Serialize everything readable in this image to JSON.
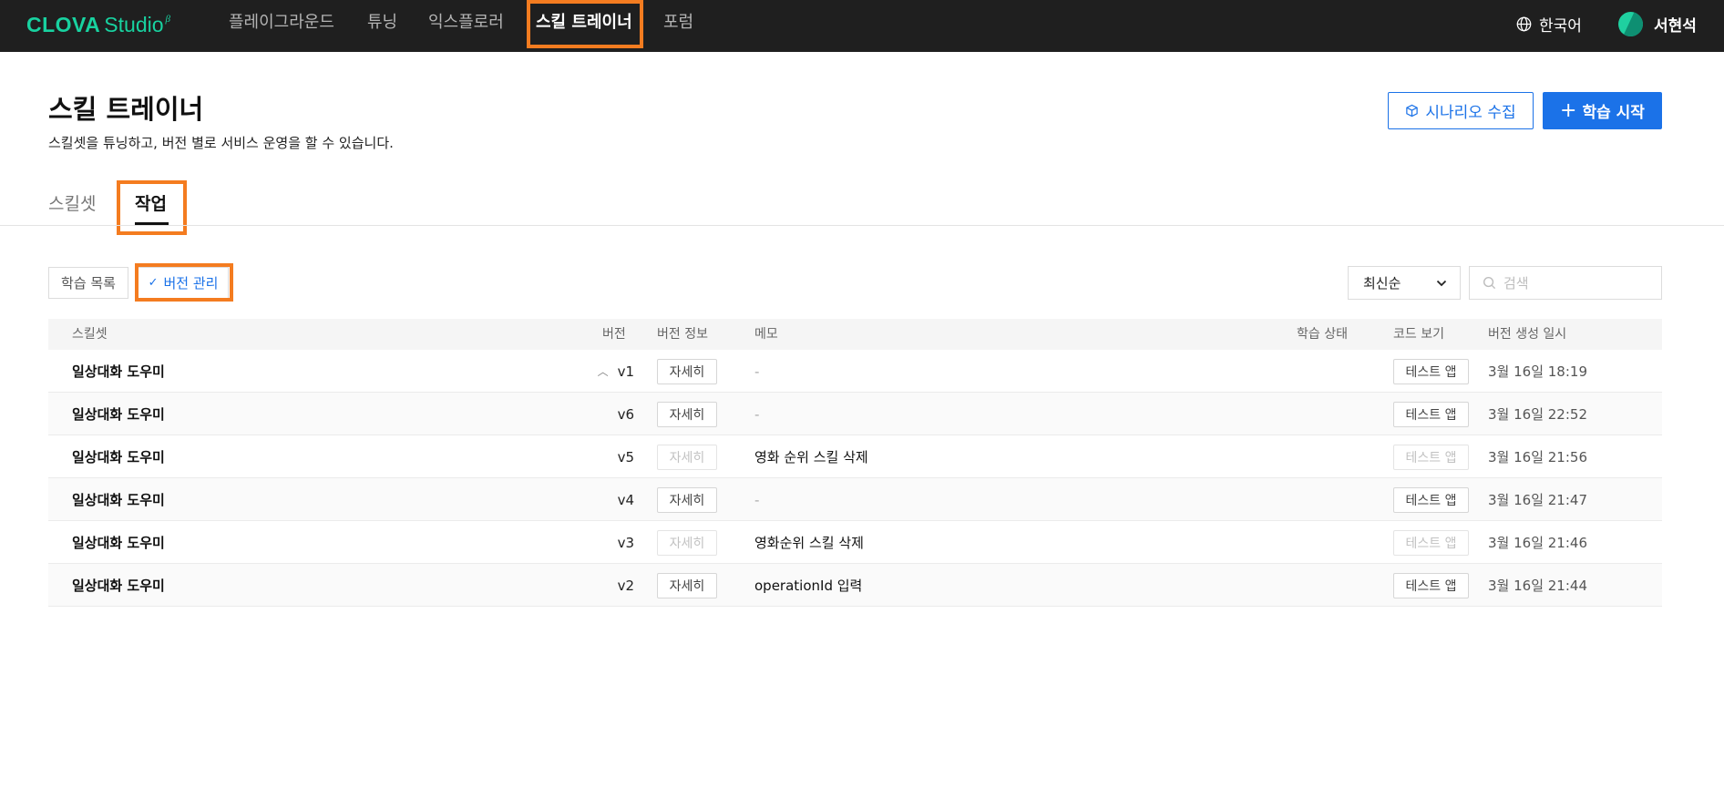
{
  "nav": {
    "logo_main": "CLOVA",
    "logo_sub": "Studio",
    "logo_beta": "β",
    "items": [
      "플레이그라운드",
      "튜닝",
      "익스플로러",
      "스킬 트레이너",
      "포럼"
    ],
    "language": "한국어",
    "user_name": "서현석"
  },
  "header": {
    "title": "스킬 트레이너",
    "description": "스킬셋을 튜닝하고, 버전 별로 서비스 운영을 할 수 있습니다.",
    "collect_button": "시나리오 수집",
    "start_button": "학습 시작"
  },
  "tabs": [
    "스킬셋",
    "작업"
  ],
  "toolbar": {
    "learn_list": "학습 목록",
    "version_manage": "버전 관리",
    "sort_value": "최신순",
    "search_placeholder": "검색"
  },
  "table": {
    "columns": [
      "스킬셋",
      "버전",
      "버전 정보",
      "메모",
      "학습 상태",
      "코드 보기",
      "버전 생성 일시"
    ],
    "detail_label": "자세히",
    "test_app_label": "테스트 앱",
    "rows": [
      {
        "skill": "일상대화 도우미",
        "version": "v1",
        "expanded": true,
        "detail_enabled": true,
        "memo": "-",
        "test_enabled": true,
        "date": "3월 16일 18:19"
      },
      {
        "skill": "일상대화 도우미",
        "version": "v6",
        "expanded": false,
        "detail_enabled": true,
        "memo": "-",
        "test_enabled": true,
        "date": "3월 16일 22:52"
      },
      {
        "skill": "일상대화 도우미",
        "version": "v5",
        "expanded": false,
        "detail_enabled": false,
        "memo": "영화 순위 스킬 삭제",
        "test_enabled": false,
        "date": "3월 16일 21:56"
      },
      {
        "skill": "일상대화 도우미",
        "version": "v4",
        "expanded": false,
        "detail_enabled": true,
        "memo": "-",
        "test_enabled": true,
        "date": "3월 16일 21:47"
      },
      {
        "skill": "일상대화 도우미",
        "version": "v3",
        "expanded": false,
        "detail_enabled": false,
        "memo": "영화순위 스킬 삭제",
        "test_enabled": false,
        "date": "3월 16일 21:46"
      },
      {
        "skill": "일상대화 도우미",
        "version": "v2",
        "expanded": false,
        "detail_enabled": true,
        "memo": "operationId 입력",
        "test_enabled": true,
        "date": "3월 16일 21:44"
      }
    ]
  },
  "colors": {
    "accent": "#1b72e8",
    "brand": "#18d2a0",
    "highlight": "#f47c20",
    "topbar": "#1f1f1f"
  }
}
